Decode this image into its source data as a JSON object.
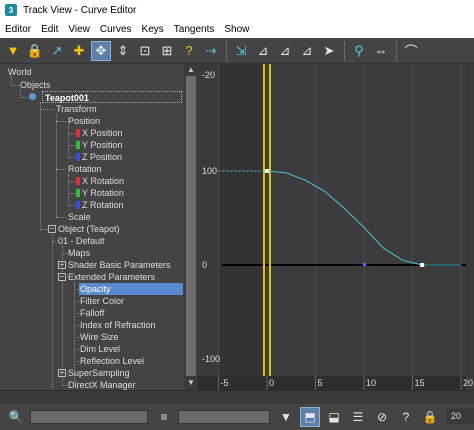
{
  "window": {
    "title": "Track View - Curve Editor",
    "app_icon": "3"
  },
  "menu": [
    "Editor",
    "Edit",
    "View",
    "Curves",
    "Keys",
    "Tangents",
    "Show"
  ],
  "toolbar": {
    "icons": [
      "filter-icon",
      "lock-selection-icon",
      "move-keys-icon",
      "add-keys-icon",
      "slide-keys-icon",
      "scale-keys-icon",
      "scale-values-icon",
      "region-icon",
      "set-tangents-auto-icon",
      "set-tangents-custom-icon",
      "pan-icon",
      "snap-frames-icon",
      "lock-tangents-icon",
      "show-keys-icon",
      "select-icon",
      "parameter-curve-icon",
      "tangent-icon",
      "curve-linear-icon"
    ]
  },
  "tree": {
    "items": [
      {
        "label": "World"
      },
      {
        "label": "Objects"
      },
      {
        "label": "Teapot001"
      },
      {
        "label": "Transform"
      },
      {
        "label": "Position"
      },
      {
        "label": "X Position",
        "color": "#e03030"
      },
      {
        "label": "Y Position",
        "color": "#30c030"
      },
      {
        "label": "Z Position",
        "color": "#3050e0"
      },
      {
        "label": "Rotation"
      },
      {
        "label": "X Rotation",
        "color": "#e03030"
      },
      {
        "label": "Y Rotation",
        "color": "#30c030"
      },
      {
        "label": "Z Rotation",
        "color": "#3050e0"
      },
      {
        "label": "Scale"
      },
      {
        "label": "Object (Teapot)"
      },
      {
        "label": "01 - Default"
      },
      {
        "label": "Maps"
      },
      {
        "label": "Shader Basic Parameters"
      },
      {
        "label": "Extended Parameters"
      },
      {
        "label": "Opacity"
      },
      {
        "label": "Filter Color"
      },
      {
        "label": "Falloff"
      },
      {
        "label": "Index of Refraction"
      },
      {
        "label": "Wire Size"
      },
      {
        "label": "Dim Level"
      },
      {
        "label": "Reflection Level"
      },
      {
        "label": "SuperSampling"
      },
      {
        "label": "DirectX Manager"
      }
    ],
    "expand_plus": "+",
    "expand_minus": "−"
  },
  "curve_editor": {
    "y_labels": [
      "100",
      "0",
      "-100"
    ],
    "corner_label": "-20",
    "x_labels": [
      "-5",
      "0",
      "5",
      "10",
      "15",
      "20"
    ],
    "curve_color": "#4fc3d8",
    "time_slider_color": "#e8c400"
  },
  "chart_data": {
    "type": "line",
    "series": [
      {
        "x": [
          -5,
          0,
          2,
          4,
          6,
          8,
          10,
          12,
          14,
          16,
          18,
          20
        ],
        "values": [
          100,
          100,
          98,
          90,
          78,
          60,
          40,
          18,
          5,
          0,
          0,
          0
        ]
      }
    ],
    "keys": [
      {
        "x": 0,
        "y": 100
      },
      {
        "x": 16,
        "y": 0
      }
    ],
    "xlim": [
      -5,
      20
    ],
    "ylim": [
      -100,
      100
    ]
  },
  "bottombar": {
    "icons": [
      "zoom-icon",
      "selection-field",
      "filter-list-icon",
      "zoom-region-icon",
      "zoom-extents-icon",
      "zoom-horizontal-icon",
      "zoom-value-icon",
      "isolate-icon",
      "lock-icon"
    ],
    "frame_value": "20"
  }
}
